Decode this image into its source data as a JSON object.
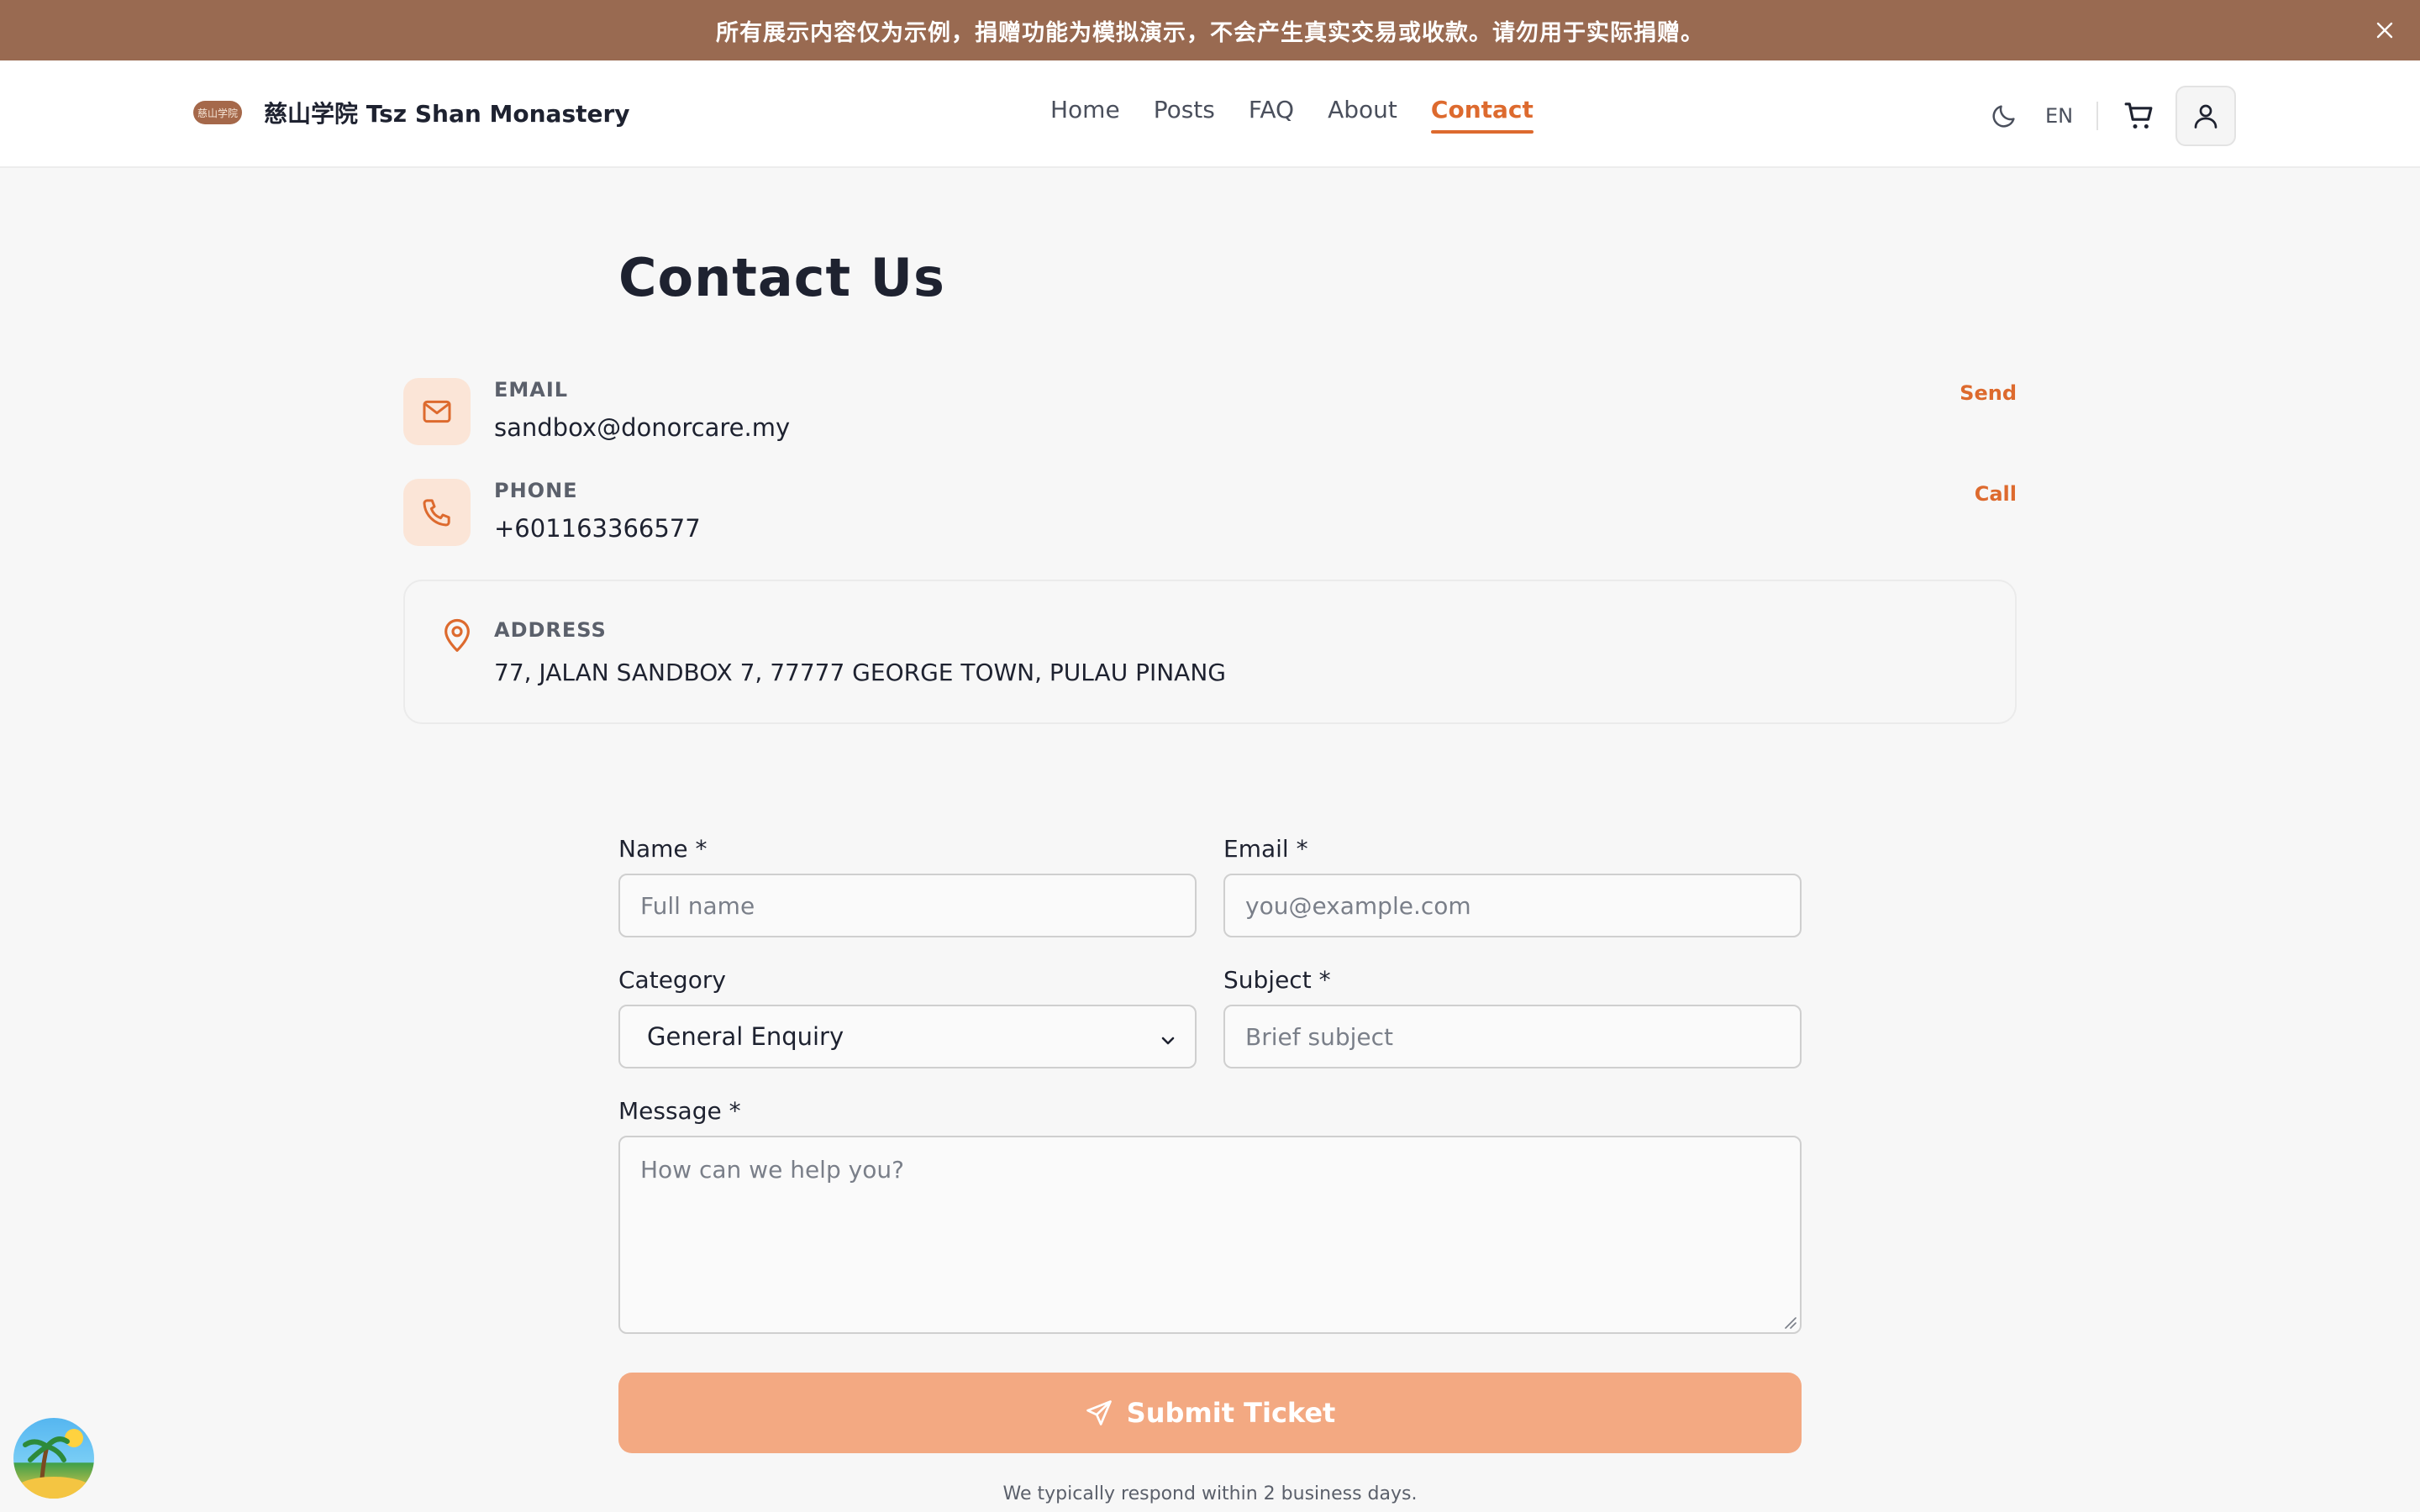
{
  "banner": {
    "text": "所有展示内容仅为示例，捐赠功能为模拟演示，不会产生真实交易或收款。请勿用于实际捐赠。",
    "close_icon": "close-icon"
  },
  "header": {
    "logo_text": "慈山学院",
    "brand_name": "慈山学院 Tsz Shan Monastery",
    "nav": [
      {
        "label": "Home",
        "active": false
      },
      {
        "label": "Posts",
        "active": false
      },
      {
        "label": "FAQ",
        "active": false
      },
      {
        "label": "About",
        "active": false
      },
      {
        "label": "Contact",
        "active": true
      }
    ],
    "lang": "EN",
    "icons": [
      "moon-icon",
      "cart-icon",
      "user-icon"
    ]
  },
  "page": {
    "title": "Contact Us"
  },
  "contacts": {
    "email": {
      "label": "EMAIL",
      "value": "sandbox@donorcare.my",
      "action": "Send"
    },
    "phone": {
      "label": "PHONE",
      "value": "+601163366577",
      "action": "Call"
    },
    "address": {
      "label": "ADDRESS",
      "value": "77, JALAN SANDBOX 7, 77777 GEORGE TOWN, PULAU PINANG"
    }
  },
  "form": {
    "name": {
      "label": "Name *",
      "placeholder": "Full name"
    },
    "email": {
      "label": "Email *",
      "placeholder": "you@example.com"
    },
    "category": {
      "label": "Category",
      "selected": "General Enquiry"
    },
    "subject": {
      "label": "Subject *",
      "placeholder": "Brief subject"
    },
    "message": {
      "label": "Message *",
      "placeholder": "How can we help you?"
    },
    "submit_label": "Submit Ticket",
    "note": "We typically respond within 2 business days."
  },
  "colors": {
    "accent": "#dd6a2e",
    "banner": "#996a51",
    "submit": "#f3a982",
    "icon_bg": "#fbe5d7"
  }
}
